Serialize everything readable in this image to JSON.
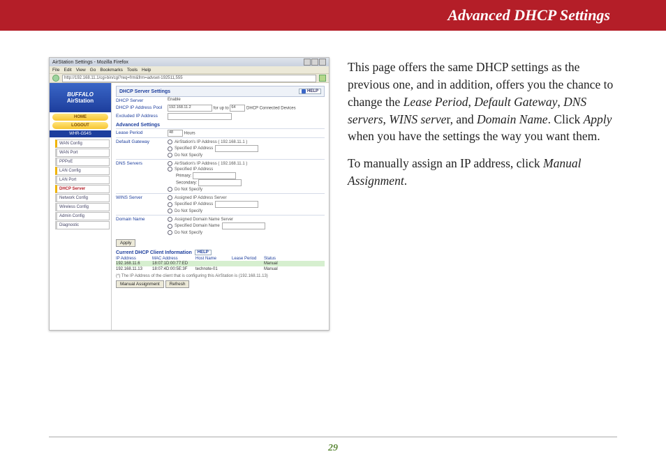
{
  "page": {
    "title": "Advanced DHCP Settings",
    "number": "29"
  },
  "body": {
    "p1_a": "This page offers the same DHCP settings as the previous one, and in addition, offers you the chance to change the ",
    "p1_lease": "Lease Period",
    "p1_b": ", ",
    "p1_gw": "De­fault Gateway",
    "p1_c": ", ",
    "p1_dns": "DNS servers",
    "p1_d": ", ",
    "p1_wins": "WINS serve",
    "p1_wins_tail": "r, and ",
    "p1_dn": "Domain Name",
    "p1_e": ".  Click ",
    "p1_apply": "Apply",
    "p1_f": " when you have the settings the way you want them.",
    "p2_a": "To manually assign an IP address, click ",
    "p2_link": "Manual Assignment",
    "p2_b": "."
  },
  "screenshot": {
    "window_title": "AirStation Settings - Mozilla Firefox",
    "menu": [
      "File",
      "Edit",
      "View",
      "Go",
      "Bookmarks",
      "Tools",
      "Help"
    ],
    "url": "http://192.168.11.1/cgi-bin/cgi?req=frm&frm=advset-192511,555",
    "brand": "BUFFALO",
    "product": "AirStation",
    "home": "HOME",
    "logout": "LOGOUT",
    "model": "WHR-G54S",
    "nav": {
      "wan": "WAN Config",
      "wanport": "WAN Port",
      "pppoe": "PPPoE",
      "lan": "LAN Config",
      "lanport": "LAN Port",
      "dhcp": "DHCP Server",
      "net": "Network Config",
      "wireless": "Wireless Config",
      "admin": "Admin Config",
      "diag": "Diagnostic"
    },
    "panel_title": "DHCP Server Settings",
    "help": "HELP",
    "rows": {
      "dhcp_server_lbl": "DHCP Server",
      "dhcp_server_val": "Enable",
      "pool_lbl": "DHCP IP Address Pool",
      "pool_ip": "192.168.11.2",
      "pool_for": "for up to",
      "pool_count": "64",
      "pool_tail": "DHCP Connected Devices",
      "excluded": "Excluded IP Address",
      "adv_head": "Advanced Settings",
      "lease_lbl": "Lease Period",
      "lease_val": "48",
      "lease_unit": "Hours",
      "gw_lbl": "Default Gateway",
      "gw_opt1": "AirStation's IP Address ( 192.168.11.1 )",
      "gw_opt2": "Specified IP Address",
      "gw_opt3": "Do Not Specify",
      "dns_lbl": "DNS Servers",
      "dns_opt1": "AirStation's IP Address ( 192.168.11.1 )",
      "dns_opt2": "Specified IP Address",
      "dns_primary": "Primary:",
      "dns_secondary": "Secondary:",
      "dns_opt3": "Do Not Specify",
      "wins_lbl": "WINS Server",
      "wins_opt1": "Assigned IP Address Server",
      "wins_opt2": "Specified IP Address",
      "wins_opt3": "Do Not Specify",
      "dn_lbl": "Domain Name",
      "dn_opt1": "Assigned Domain Name Server",
      "dn_opt2": "Specified Domain Name",
      "dn_opt3": "Do Not Specify",
      "apply_btn": "Apply"
    },
    "clients": {
      "head": "Current DHCP Client Information",
      "cols": [
        "IP Address",
        "MAC Address",
        "Host Name",
        "Lease Period",
        "Status"
      ],
      "r1": [
        "192.168.11.6",
        "18:07:1D:00:77:ED",
        "",
        "",
        "Manual"
      ],
      "r2": [
        "192.168.11.13",
        "18:07:4D:00:5E:3F",
        "technote-01",
        "",
        "Manual"
      ],
      "note": "(*) The IP Address of the client that is configuring this AirStation is (192.168.11.13)",
      "manual_btn": "Manual Assignment",
      "refresh_btn": "Refresh"
    }
  }
}
